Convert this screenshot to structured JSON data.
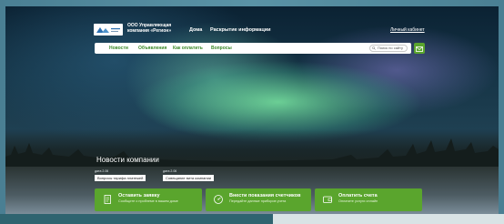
{
  "header": {
    "company_name": "ООО Управляющая компания «Регион»",
    "nav": {
      "home": "Дома",
      "disclosure": "Раскрытие информации"
    },
    "personal_account": "Личный кабинет"
  },
  "menu": {
    "items": [
      "Новости",
      "Объявления",
      "Как оплатить",
      "Вопросы"
    ],
    "search_label": "Поиск по сайту",
    "mail_icon": "mail-icon"
  },
  "news": {
    "title": "Новости компании",
    "items": [
      {
        "date": "дата 2.06",
        "tag": "Вопросы тарифа платежей"
      },
      {
        "date": "дата 2.06",
        "tag": "Совещание вита компании"
      }
    ]
  },
  "actions": [
    {
      "title": "Оставить заявку",
      "subtitle": "Сообщите о проблеме в вашем доме",
      "icon": "document-icon"
    },
    {
      "title": "Внести показания счетчиков",
      "subtitle": "Передайте данные приборов учета",
      "icon": "meter-icon"
    },
    {
      "title": "Оплатить счета",
      "subtitle": "Оплатите услуги онлайн",
      "icon": "wallet-icon"
    }
  ],
  "colors": {
    "accent": "#5aa52d",
    "link": "#3d8a2a"
  }
}
